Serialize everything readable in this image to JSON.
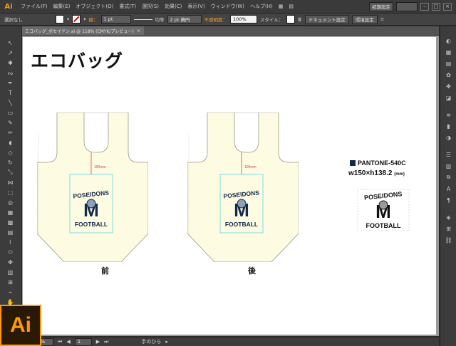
{
  "app": {
    "logo": "Ai"
  },
  "menu": {
    "items": [
      "ファイル(F)",
      "編集(E)",
      "オブジェクト(O)",
      "書式(T)",
      "選択(S)",
      "効果(C)",
      "表示(V)",
      "ウィンドウ(W)",
      "ヘルプ(H)"
    ],
    "workspace": "初期設定"
  },
  "control": {
    "selection_status": "選択なし",
    "stroke_label": "線：",
    "stroke_weight": "1 pt",
    "profile": "均等",
    "brush": "2 pt 楕円",
    "opacity_label": "不透明度：",
    "opacity_value": "100%",
    "style_label": "スタイル：",
    "doc_setup": "ドキュメント設定",
    "preferences": "環境設定"
  },
  "doc_tab": {
    "name": "エコバッグ_ポセイドン.ai @ 118% (CMYK/プレビュー)",
    "close": "×"
  },
  "artwork": {
    "title": "エコバッグ",
    "bags": [
      {
        "caption": "前",
        "dimension_label": "100mm"
      },
      {
        "caption": "後",
        "dimension_label": "100mm"
      }
    ],
    "logo": {
      "arc_text": "POSEIDONS",
      "letter": "M",
      "bottom_text": "FOOTBALL"
    },
    "spec": {
      "pantone": "PANTONE-540C",
      "size": "w150×h138.2",
      "unit": "(mm)"
    }
  },
  "status": {
    "zoom": "118%",
    "page": "1",
    "tool": "手のひら"
  },
  "colors": {
    "bag_fill": "#fdfbe1",
    "bag_stroke": "#9a9a86",
    "logo_navy": "#13294b",
    "guide_cyan": "#5fd5e5",
    "guide_red": "#e0463c",
    "ai_orange": "#ff9a00"
  }
}
